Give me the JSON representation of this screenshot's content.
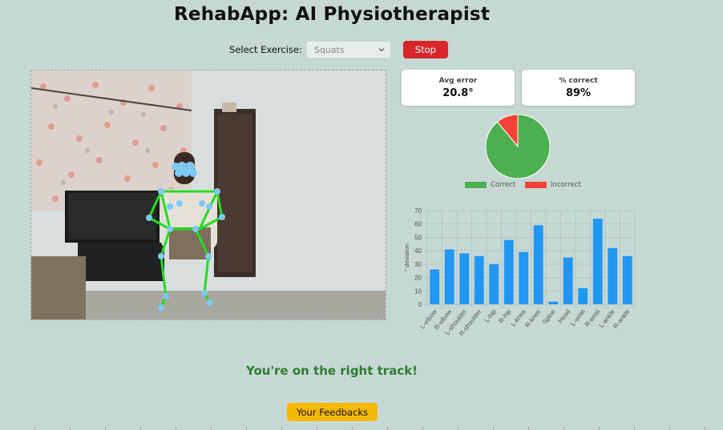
{
  "app": {
    "title": "RehabApp: AI Physiotherapist"
  },
  "controls": {
    "select_label": "Select Exercise:",
    "exercise_value": "Squats",
    "stop_label": "Stop"
  },
  "stats": {
    "avg_error_label": "Avg error",
    "avg_error_value": "20.8°",
    "pct_correct_label": "% correct",
    "pct_correct_value": "89%"
  },
  "colors": {
    "correct": "#4caf50",
    "incorrect": "#f44336",
    "bar": "#2196f3",
    "skeleton": "#22dd22",
    "joint": "#7ec8f0",
    "stop": "#d9262b",
    "feedback_button": "#f5b800",
    "message": "#2f7d32"
  },
  "chart_data": [
    {
      "type": "pie",
      "labels": [
        "Correct",
        "Incorrect"
      ],
      "values": [
        89,
        11
      ]
    },
    {
      "type": "bar",
      "categories": [
        "L-elbow",
        "R-elbow",
        "L-shoulder",
        "R-shoulder",
        "L-hip",
        "R-hip",
        "L-knee",
        "R-knee",
        "Spine",
        "Head",
        "L-wrist",
        "R-wrist",
        "L-ankle",
        "R-ankle"
      ],
      "values": [
        26,
        41,
        38,
        36,
        30,
        48,
        39,
        59,
        2,
        35,
        12,
        64,
        42,
        36
      ],
      "ylabel": "° deviation",
      "yticks": [
        0,
        10,
        20,
        30,
        40,
        50,
        60,
        70
      ],
      "ylim": [
        0,
        70
      ],
      "grid": true
    }
  ],
  "feedback": {
    "message": "You're on the right track!",
    "button_label": "Your Feedbacks"
  }
}
